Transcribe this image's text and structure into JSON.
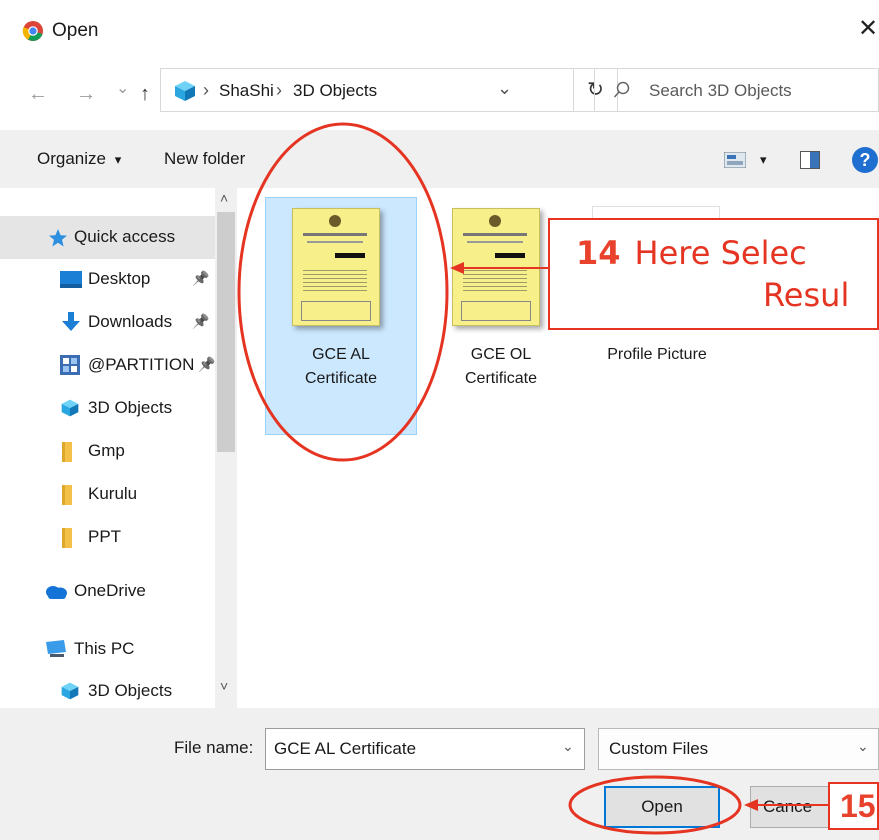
{
  "window": {
    "title": "Open",
    "close_glyph": "✕"
  },
  "address": {
    "back": "←",
    "forward": "→",
    "recent": "⌄",
    "up": "↑",
    "separator": "›",
    "crumbs": [
      "ShaShi",
      "3D Objects"
    ],
    "dropdown": "⌄",
    "refresh": "↻",
    "search_placeholder": "Search 3D Objects"
  },
  "toolbar": {
    "organize": "Organize",
    "organize_caret": "▾",
    "new_folder": "New folder",
    "view_caret": "▾",
    "help": "?"
  },
  "sidebar": {
    "items": [
      {
        "label": "Quick access",
        "icon": "star-icon",
        "pinned": false,
        "selected": true
      },
      {
        "label": "Desktop",
        "icon": "desktop-icon",
        "pinned": true
      },
      {
        "label": "Downloads",
        "icon": "download-arrow-icon",
        "pinned": true
      },
      {
        "label": "@PARTITION",
        "icon": "partition-icon",
        "pinned": true
      },
      {
        "label": "3D Objects",
        "icon": "cube-icon",
        "pinned": false
      },
      {
        "label": "Gmp",
        "icon": "folder-icon",
        "pinned": false
      },
      {
        "label": "Kurulu",
        "icon": "folder-icon",
        "pinned": false
      },
      {
        "label": "PPT",
        "icon": "folder-icon",
        "pinned": false
      },
      {
        "label": "OneDrive",
        "icon": "cloud-icon",
        "pinned": false
      },
      {
        "label": "This PC",
        "icon": "computer-icon",
        "pinned": false
      },
      {
        "label": "3D Objects",
        "icon": "cube-icon",
        "pinned": false
      }
    ],
    "pin_glyph": "📌"
  },
  "files": [
    {
      "line1": "GCE AL",
      "line2": "Certificate",
      "selected": true
    },
    {
      "line1": "GCE OL",
      "line2": "Certificate",
      "selected": false
    },
    {
      "line1": "Profile Picture",
      "line2": "",
      "selected": false
    }
  ],
  "footer": {
    "file_name_label": "File name:",
    "file_name_value": "GCE AL Certificate",
    "filter_value": "Custom Files",
    "open_button": "Open",
    "cancel_button": "Cance"
  },
  "annotations": {
    "step14_number": "14",
    "step14_line1": "Here Selec",
    "step14_line2": "Resul",
    "step15_number": "15"
  },
  "colors": {
    "annotation_red": "#e53522",
    "selection_blue": "#cce8ff",
    "focus_blue": "#0078d7"
  }
}
